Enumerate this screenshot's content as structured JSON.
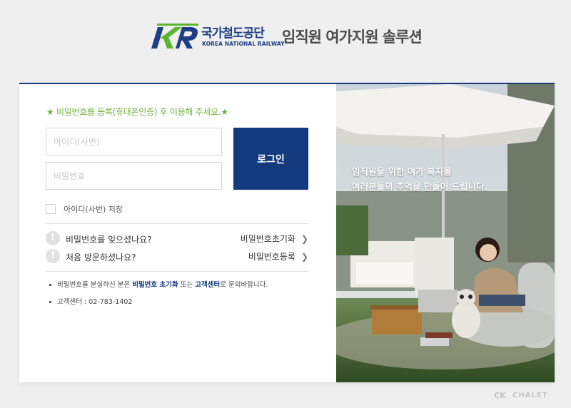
{
  "header": {
    "logo_kr": "국가철도공단",
    "logo_en": "KOREA NATIONAL RAILWAY",
    "title": "임직원 여가지원 솔루션"
  },
  "login": {
    "notice": "★ 비밀번호를 등록(휴대폰인증) 후 이용해 주세요.★",
    "id_placeholder": "아이디(사번)",
    "pw_placeholder": "비밀번호",
    "id_value": "",
    "pw_value": "",
    "login_label": "로그인",
    "save_id_label": "아이디(사번) 저장",
    "save_id_checked": false
  },
  "help": [
    {
      "question": "비밀번호를 잊으셨나요?",
      "link": "비밀번호초기화"
    },
    {
      "question": "처음 방문하셨나요?",
      "link": "비밀번호등록"
    }
  ],
  "info": {
    "line1_prefix": "비밀번호를 분실하신 분은 ",
    "line1_link1": "비밀번호 초기화",
    "line1_mid": " 또는 ",
    "line1_link2": "고객센터",
    "line1_suffix": "로 문의바랍니다.",
    "line2": "고객센터 : 02-783-1402"
  },
  "promo": {
    "caption_line1": "임직원을 위한 여가 복지몰",
    "caption_line2": "여러분들의 추억을 만들어 드립니다."
  },
  "watermark": {
    "icon": "CK",
    "text": "CHALET"
  },
  "icons": {
    "help": "exclamation-icon",
    "chevron": "chevron-right-icon"
  },
  "colors": {
    "brand_blue": "#123a7d",
    "brand_green": "#5cb531",
    "notice_green": "#6fb23b"
  }
}
